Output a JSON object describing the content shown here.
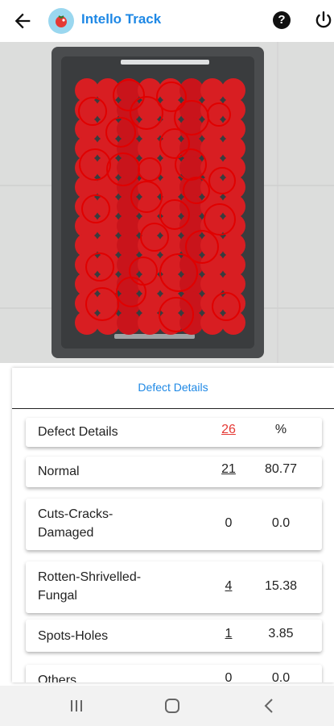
{
  "header": {
    "title": "Intello Track",
    "icons": [
      "back-arrow-icon",
      "tomato-logo-icon",
      "help-icon",
      "power-icon"
    ],
    "help_glyph": "?"
  },
  "photo": {
    "description_icon": "tomato-crate-photo"
  },
  "panel": {
    "title": "Defect Details",
    "rows": [
      {
        "label": "Defect Details",
        "count": "26",
        "pct": "%"
      },
      {
        "label": "Normal",
        "count": "21",
        "pct": "80.77"
      },
      {
        "label": "Cuts-Cracks-Damaged",
        "label_line1": "Cuts-Cracks-",
        "label_line2": "Damaged",
        "count": "0",
        "pct": "0.0"
      },
      {
        "label": "Rotten-Shrivelled-Fungal",
        "label_line1": "Rotten-Shrivelled-",
        "label_line2": "Fungal",
        "count": "4",
        "pct": "15.38"
      },
      {
        "label": "Spots-Holes",
        "count": "1",
        "pct": "3.85"
      },
      {
        "label": "Others",
        "count": "0",
        "pct": "0.0"
      }
    ]
  },
  "colors": {
    "accent": "#1e88e5",
    "highlight": "#e53935",
    "detection_circle": "#e00000"
  },
  "navbar": {
    "icons": [
      "recent-apps-icon",
      "home-icon",
      "back-icon"
    ]
  }
}
